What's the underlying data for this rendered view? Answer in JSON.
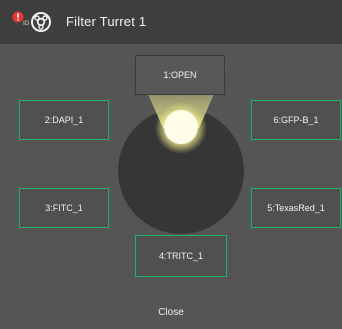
{
  "window": {
    "title": "Filter Turret 1"
  },
  "filters": [
    {
      "label": "1:OPEN",
      "selected": true
    },
    {
      "label": "2:DAPI_1",
      "selected": false
    },
    {
      "label": "3:FITC_1",
      "selected": false
    },
    {
      "label": "4:TRITC_1",
      "selected": false
    },
    {
      "label": "5:TexasRed_1",
      "selected": false
    },
    {
      "label": "6:GFP-B_1",
      "selected": false
    }
  ],
  "footer": {
    "close_label": "Close"
  },
  "colors": {
    "border_accent": "#1fb36a",
    "light": "#fffbd0",
    "alert": "#e53935"
  }
}
